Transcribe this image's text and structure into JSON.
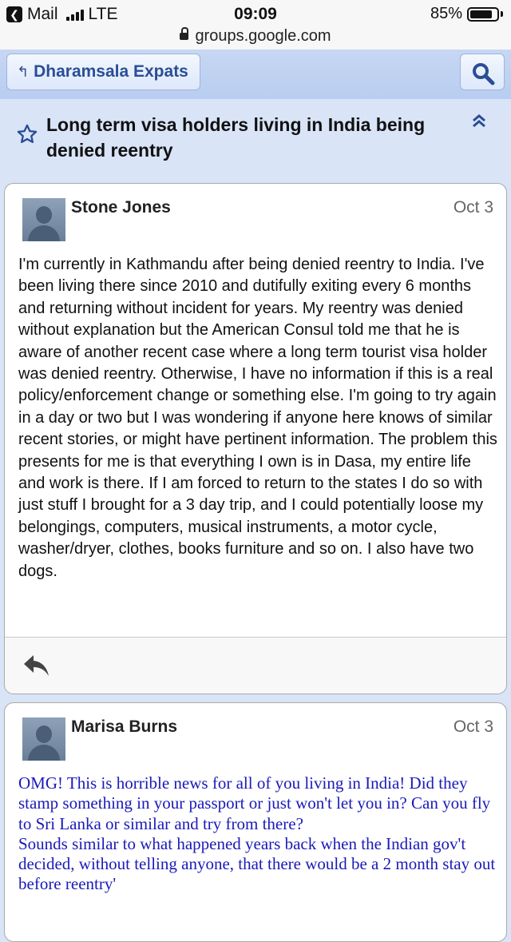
{
  "status_bar": {
    "back_app": "Mail",
    "network": "LTE",
    "time": "09:09",
    "battery": "85%",
    "battery_level": 0.85,
    "url": "groups.google.com"
  },
  "group": {
    "name": "Dharamsala Expats"
  },
  "thread": {
    "title": "Long term visa holders living in India being denied reentry"
  },
  "posts": [
    {
      "author": "Stone Jones",
      "date": "Oct 3",
      "body": "I'm currently in Kathmandu after being denied reentry to India. I've been living there since 2010 and dutifully exiting every 6 months and returning without incident for years. My reentry was denied without explanation but the American Consul told me that he is aware of another recent case where a long term tourist visa holder was denied reentry. Otherwise, I have no information if this is a real policy/enforcement change or something else. I'm going to try again in a day or two but I was wondering if anyone here knows of similar recent stories, or might have pertinent information. The problem this presents for me is that everything I own is in Dasa, my entire life and work is there. If I am forced to return to the states I do so with just stuff I brought for a 3 day trip, and I could potentially loose my belongings, computers, musical instruments, a motor cycle, washer/dryer, clothes, books furniture and so on. I also have two dogs."
    },
    {
      "author": "Marisa Burns",
      "date": "Oct 3",
      "body_line1": "OMG!  This is horrible news for all of you living in India!  Did they stamp something in your passport or just won't let you in?  Can you fly to Sri Lanka or similar and try from there?",
      "body_line2": "Sounds similar to what happened years back when the Indian gov't decided, without telling anyone, that there would be a 2 month stay out before reentry'"
    }
  ],
  "colors": {
    "header_blue": "#b8cdf0",
    "link_blue": "#2a4e95",
    "quoted_text_blue": "#1a1ab8"
  }
}
